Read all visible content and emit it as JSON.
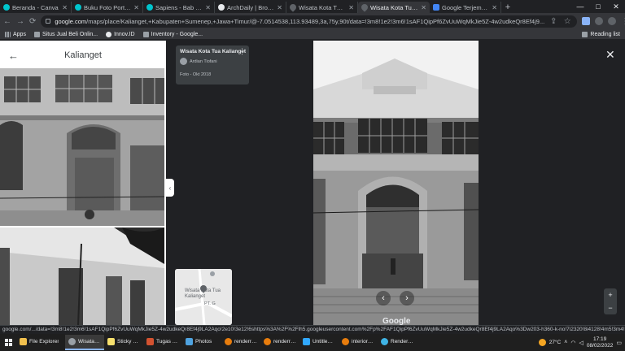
{
  "browser": {
    "tabs": [
      {
        "label": "Beranda - Canva",
        "icon": "canva-icon",
        "active": false
      },
      {
        "label": "Buku Foto Portfolio F",
        "icon": "canva-icon",
        "active": false
      },
      {
        "label": "Sapiens - Bab 14. Pe",
        "icon": "canva-icon",
        "active": false
      },
      {
        "label": "ArchDaily | Broadcast",
        "icon": "archdaily-icon",
        "active": false
      },
      {
        "label": "Wisata Kota Tua Kali",
        "icon": "maps-icon",
        "active": false
      },
      {
        "label": "Wisata Kota Tua Kalia",
        "icon": "maps-icon",
        "active": true
      },
      {
        "label": "Google Terjemahan",
        "icon": "google-translate-icon",
        "active": false
      }
    ],
    "new_tab": "+",
    "window_controls": {
      "minimize": "—",
      "maximize": "□",
      "close": "✕"
    },
    "url_host": "google.com",
    "url_path": "/maps/place/Kalianget,+Kabupaten+Sumenep,+Jawa+Timur/@-7.0514538,113.93489,3a,75y,90t/data=!3m8!1e2!3m6!1sAF1QipPf6ZvUuWqMkJie5Z-4w2udkeQr8Ef4j9...",
    "bookmarks": [
      {
        "label": "Apps",
        "icon": "apps-grid-icon"
      },
      {
        "label": "Situs Jual Beli Onlin...",
        "icon": "bookmark-icon"
      },
      {
        "label": "Innov.ID",
        "icon": "innov-icon"
      },
      {
        "label": "Inventory - Google...",
        "icon": "drive-icon"
      }
    ],
    "reading_list": "Reading list"
  },
  "maps": {
    "panel_title": "Kalianget",
    "photo_card": {
      "title": "Wisata Kota Tua Kalianget",
      "author": "Ardian Tiofani",
      "date": "Foto - Okt 2018"
    },
    "minimap": {
      "label": "Wisata Kota Tua Kalianget",
      "label2": "PT. G"
    },
    "google_logo": "Google",
    "zoom_in": "+",
    "zoom_out": "−",
    "close": "✕",
    "prev": "‹",
    "next": "›",
    "collapse": "‹",
    "back": "←",
    "more": "⋮"
  },
  "status_url": "google.com/.../data=!3m8!1e2!3m6!1sAF1QipPf6ZvUuWqMkJie5Z-4w2udkeQr8Ef4j9LA2Aqo!2e10!3e12!6shttps%3A%2F%2Flh5.googleusercontent.com%2Fp%2FAF1QipPf6ZvUuWqMkJie5Z-4w2udkeQr8Ef4j9LA2Aqo%3Dw203-h360-k-no!7i2320!8i4128!4m5!3m4!1s0x2dd9e3841ac3383...",
  "taskbar": {
    "items": [
      {
        "label": "File Explorer",
        "icon": "folder-icon",
        "active": false
      },
      {
        "label": "Wisata Kot...",
        "icon": "chrome-icon",
        "active": true
      },
      {
        "label": "Sticky Notes",
        "icon": "sticky-notes-icon",
        "active": false
      },
      {
        "label": "Tugas 3_Fat...",
        "icon": "powerpoint-icon",
        "active": false
      },
      {
        "label": "Photos",
        "icon": "photos-icon",
        "active": false
      },
      {
        "label": "renderrr - S...",
        "icon": "blender-icon",
        "active": false
      },
      {
        "label": "renderrr - S...",
        "icon": "blender-icon",
        "active": false
      },
      {
        "label": "Untitled-2 ...",
        "icon": "photoshop-icon",
        "active": false
      },
      {
        "label": "interior - S...",
        "icon": "blender-icon",
        "active": false
      },
      {
        "label": "Render Ka...",
        "icon": "edge-icon",
        "active": false
      }
    ],
    "weather": "27°C",
    "time": "17:19",
    "date": "08/02/2022"
  }
}
